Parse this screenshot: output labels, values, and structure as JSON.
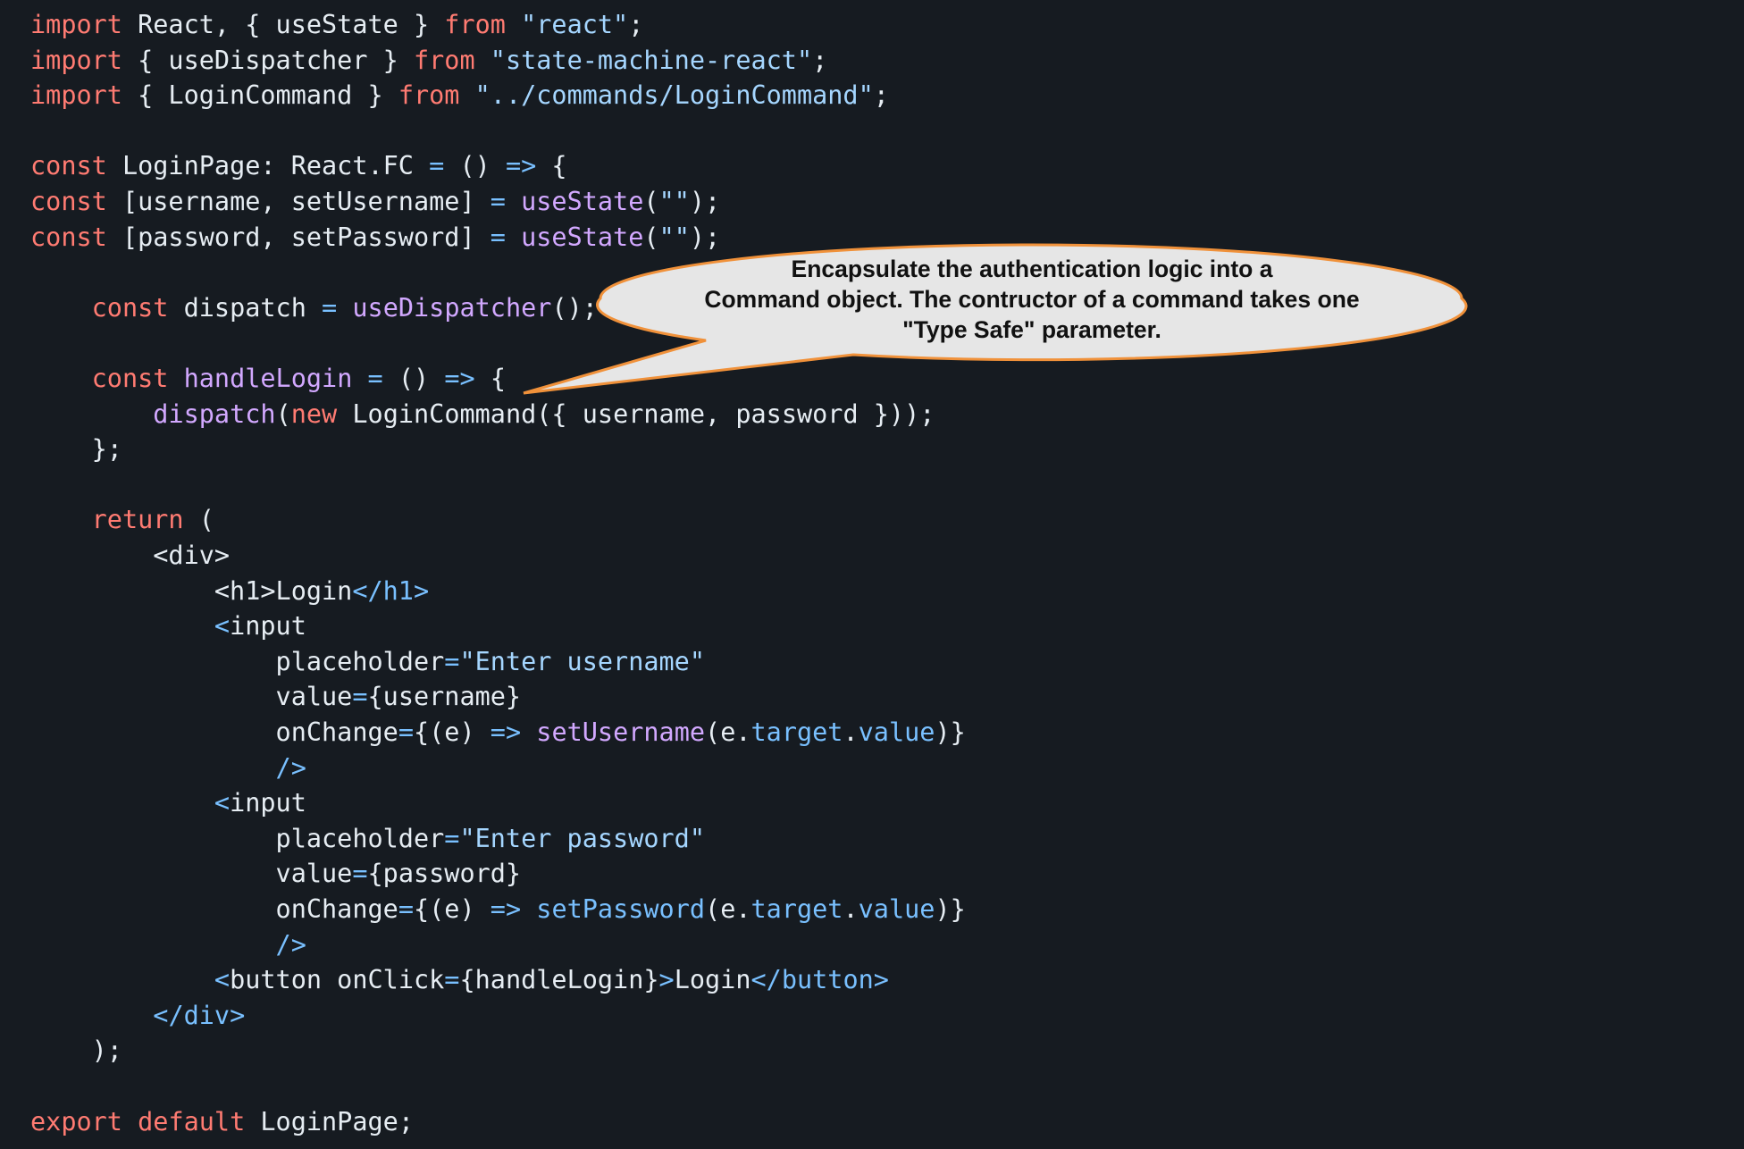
{
  "editor": {
    "colors": {
      "background": "#161b21",
      "plain": "#e6edf3",
      "keyword": "#ff7b72",
      "string": "#a5d6ff",
      "operator": "#79c0ff",
      "function": "#d2a8ff"
    },
    "lines": [
      [
        [
          "keyword",
          "import"
        ],
        [
          "plain",
          " React, { useState } "
        ],
        [
          "keyword",
          "from"
        ],
        [
          "plain",
          " "
        ],
        [
          "string",
          "\"react\""
        ],
        [
          "plain",
          ";"
        ]
      ],
      [
        [
          "keyword",
          "import"
        ],
        [
          "plain",
          " { useDispatcher } "
        ],
        [
          "keyword",
          "from"
        ],
        [
          "plain",
          " "
        ],
        [
          "string",
          "\"state-machine-react\""
        ],
        [
          "plain",
          ";"
        ]
      ],
      [
        [
          "keyword",
          "import"
        ],
        [
          "plain",
          " { LoginCommand } "
        ],
        [
          "keyword",
          "from"
        ],
        [
          "plain",
          " "
        ],
        [
          "string",
          "\"../commands/LoginCommand\""
        ],
        [
          "plain",
          ";"
        ]
      ],
      [],
      [
        [
          "keyword",
          "const"
        ],
        [
          "plain",
          " LoginPage: React.FC "
        ],
        [
          "operator",
          "="
        ],
        [
          "plain",
          " () "
        ],
        [
          "operator",
          "=>"
        ],
        [
          "plain",
          " {"
        ]
      ],
      [
        [
          "keyword",
          "const"
        ],
        [
          "plain",
          " [username, setUsername] "
        ],
        [
          "operator",
          "="
        ],
        [
          "plain",
          " "
        ],
        [
          "func",
          "useState"
        ],
        [
          "plain",
          "("
        ],
        [
          "string",
          "\"\""
        ],
        [
          "plain",
          ");"
        ]
      ],
      [
        [
          "keyword",
          "const"
        ],
        [
          "plain",
          " [password, setPassword] "
        ],
        [
          "operator",
          "="
        ],
        [
          "plain",
          " "
        ],
        [
          "func",
          "useState"
        ],
        [
          "plain",
          "("
        ],
        [
          "string",
          "\"\""
        ],
        [
          "plain",
          ");"
        ]
      ],
      [],
      [
        [
          "plain",
          "    "
        ],
        [
          "keyword",
          "const"
        ],
        [
          "plain",
          " dispatch "
        ],
        [
          "operator",
          "="
        ],
        [
          "plain",
          " "
        ],
        [
          "func",
          "useDispatcher"
        ],
        [
          "plain",
          "();"
        ]
      ],
      [],
      [
        [
          "plain",
          "    "
        ],
        [
          "keyword",
          "const"
        ],
        [
          "plain",
          " "
        ],
        [
          "func",
          "handleLogin"
        ],
        [
          "plain",
          " "
        ],
        [
          "operator",
          "="
        ],
        [
          "plain",
          " () "
        ],
        [
          "operator",
          "=>"
        ],
        [
          "plain",
          " {"
        ]
      ],
      [
        [
          "plain",
          "        "
        ],
        [
          "func",
          "dispatch"
        ],
        [
          "plain",
          "("
        ],
        [
          "keyword",
          "new"
        ],
        [
          "plain",
          " LoginCommand({ username, password }));"
        ]
      ],
      [
        [
          "plain",
          "    };"
        ]
      ],
      [],
      [
        [
          "plain",
          "    "
        ],
        [
          "keyword",
          "return"
        ],
        [
          "plain",
          " ("
        ]
      ],
      [
        [
          "plain",
          "        <div>"
        ]
      ],
      [
        [
          "plain",
          "            <h1>Login"
        ],
        [
          "operator",
          "</h1>"
        ]
      ],
      [
        [
          "plain",
          "            "
        ],
        [
          "operator",
          "<"
        ],
        [
          "plain",
          "input"
        ]
      ],
      [
        [
          "plain",
          "                placeholder"
        ],
        [
          "operator",
          "="
        ],
        [
          "string",
          "\"Enter username\""
        ]
      ],
      [
        [
          "plain",
          "                value"
        ],
        [
          "operator",
          "="
        ],
        [
          "plain",
          "{username}"
        ]
      ],
      [
        [
          "plain",
          "                onChange"
        ],
        [
          "operator",
          "="
        ],
        [
          "plain",
          "{(e) "
        ],
        [
          "operator",
          "=>"
        ],
        [
          "plain",
          " "
        ],
        [
          "func",
          "setUsername"
        ],
        [
          "plain",
          "(e."
        ],
        [
          "operator",
          "target"
        ],
        [
          "plain",
          "."
        ],
        [
          "operator",
          "value"
        ],
        [
          "plain",
          ")}"
        ]
      ],
      [
        [
          "plain",
          "                "
        ],
        [
          "operator",
          "/>"
        ]
      ],
      [
        [
          "plain",
          "            "
        ],
        [
          "operator",
          "<"
        ],
        [
          "plain",
          "input"
        ]
      ],
      [
        [
          "plain",
          "                placeholder"
        ],
        [
          "operator",
          "="
        ],
        [
          "string",
          "\"Enter password\""
        ]
      ],
      [
        [
          "plain",
          "                value"
        ],
        [
          "operator",
          "="
        ],
        [
          "plain",
          "{password}"
        ]
      ],
      [
        [
          "plain",
          "                onChange"
        ],
        [
          "operator",
          "="
        ],
        [
          "plain",
          "{(e) "
        ],
        [
          "operator",
          "=>"
        ],
        [
          "plain",
          " "
        ],
        [
          "operator",
          "setPassword"
        ],
        [
          "plain",
          "(e."
        ],
        [
          "operator",
          "target"
        ],
        [
          "plain",
          "."
        ],
        [
          "operator",
          "value"
        ],
        [
          "plain",
          ")}"
        ]
      ],
      [
        [
          "plain",
          "                "
        ],
        [
          "operator",
          "/>"
        ]
      ],
      [
        [
          "plain",
          "            "
        ],
        [
          "operator",
          "<"
        ],
        [
          "plain",
          "button onClick"
        ],
        [
          "operator",
          "="
        ],
        [
          "plain",
          "{handleLogin}"
        ],
        [
          "operator",
          ">"
        ],
        [
          "plain",
          "Login"
        ],
        [
          "operator",
          "</button>"
        ]
      ],
      [
        [
          "plain",
          "        "
        ],
        [
          "operator",
          "</div>"
        ]
      ],
      [
        [
          "plain",
          "    );"
        ]
      ],
      [],
      [
        [
          "keyword",
          "export"
        ],
        [
          "plain",
          " "
        ],
        [
          "keyword",
          "default"
        ],
        [
          "plain",
          " LoginPage;"
        ]
      ]
    ]
  },
  "callout": {
    "fill": "#e6e6e6",
    "border": "#f0913a",
    "line1": "Encapsulate the authentication logic into a",
    "line2": "Command object. The contructor of a command takes one",
    "line3": "\"Type Safe\" parameter."
  }
}
